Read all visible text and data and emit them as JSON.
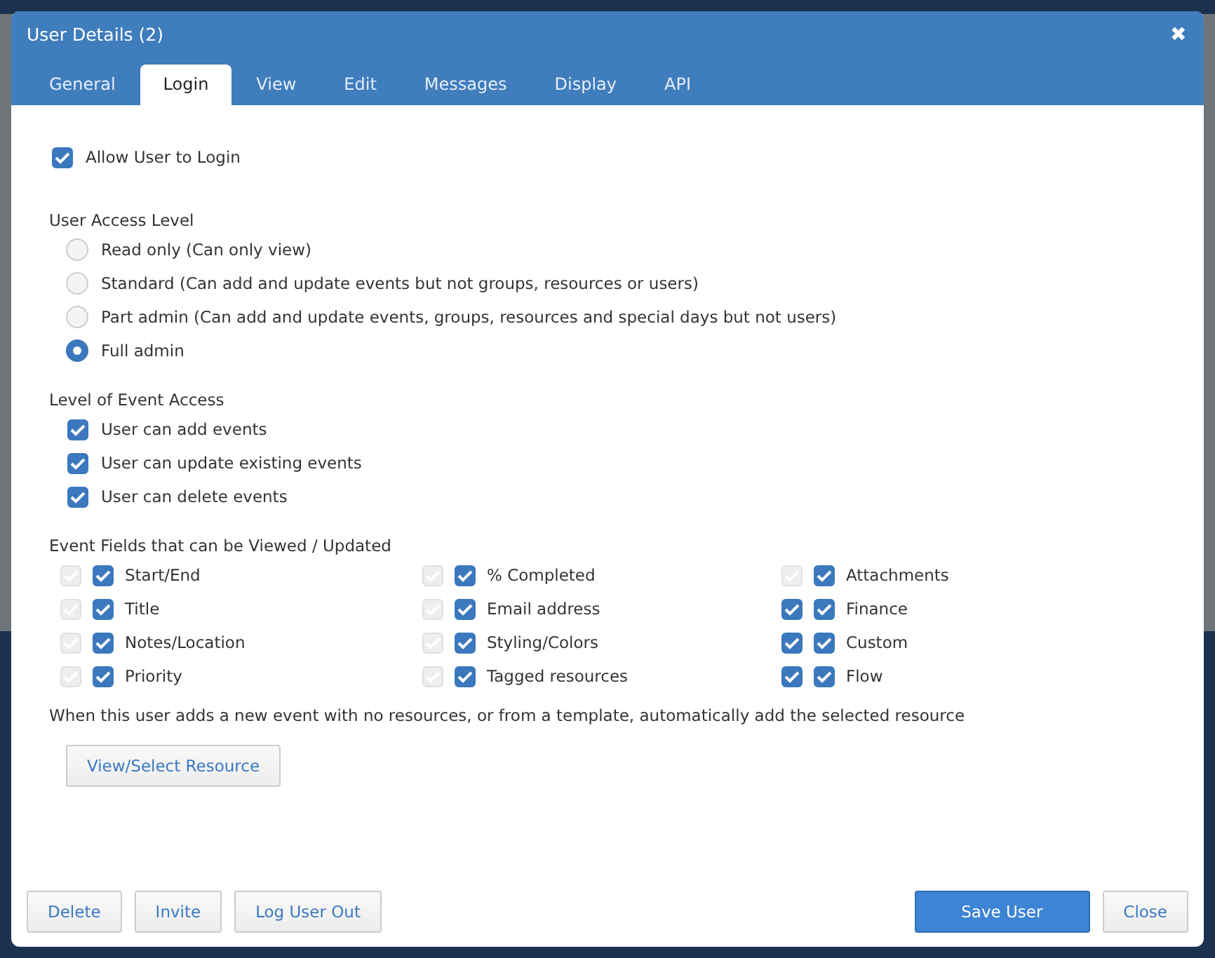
{
  "window": {
    "title": "User Details (2)",
    "close": "✖"
  },
  "tabs": [
    {
      "label": "General",
      "selected": false
    },
    {
      "label": "Login",
      "selected": true
    },
    {
      "label": "View",
      "selected": false
    },
    {
      "label": "Edit",
      "selected": false
    },
    {
      "label": "Messages",
      "selected": false
    },
    {
      "label": "Display",
      "selected": false
    },
    {
      "label": "API",
      "selected": false
    }
  ],
  "allow_login": {
    "label": "Allow User to Login",
    "checked": true
  },
  "access_level": {
    "heading": "User Access Level",
    "options": [
      {
        "label": "Read only (Can only view)",
        "selected": false
      },
      {
        "label": "Standard (Can add and update events but not groups, resources or users)",
        "selected": false
      },
      {
        "label": "Part admin (Can add and update events, groups, resources and special days but not users)",
        "selected": false
      },
      {
        "label": "Full admin",
        "selected": true
      }
    ]
  },
  "event_access": {
    "heading": "Level of Event Access",
    "options": [
      {
        "label": "User can add events",
        "checked": true
      },
      {
        "label": "User can update existing events",
        "checked": true
      },
      {
        "label": "User can delete events",
        "checked": true
      }
    ]
  },
  "event_fields": {
    "heading": "Event Fields that can be Viewed / Updated",
    "columns": [
      [
        {
          "label": "Start/End",
          "view_checked": true,
          "view_disabled": true,
          "update_checked": true
        },
        {
          "label": "Title",
          "view_checked": true,
          "view_disabled": true,
          "update_checked": true
        },
        {
          "label": "Notes/Location",
          "view_checked": true,
          "view_disabled": true,
          "update_checked": true
        },
        {
          "label": "Priority",
          "view_checked": true,
          "view_disabled": true,
          "update_checked": true
        }
      ],
      [
        {
          "label": "% Completed",
          "view_checked": true,
          "view_disabled": true,
          "update_checked": true
        },
        {
          "label": "Email address",
          "view_checked": true,
          "view_disabled": true,
          "update_checked": true
        },
        {
          "label": "Styling/Colors",
          "view_checked": true,
          "view_disabled": true,
          "update_checked": true
        },
        {
          "label": "Tagged resources",
          "view_checked": true,
          "view_disabled": true,
          "update_checked": true
        }
      ],
      [
        {
          "label": "Attachments",
          "view_checked": true,
          "view_disabled": true,
          "update_checked": true
        },
        {
          "label": "Finance",
          "view_checked": true,
          "view_disabled": false,
          "update_checked": true
        },
        {
          "label": "Custom",
          "view_checked": true,
          "view_disabled": false,
          "update_checked": true
        },
        {
          "label": "Flow",
          "view_checked": true,
          "view_disabled": false,
          "update_checked": true
        }
      ]
    ]
  },
  "resource_note": "When this user adds a new event with no resources, or from a template, automatically add the selected resource",
  "resource_button": "View/Select Resource",
  "footer": {
    "left_buttons": [
      "Delete",
      "Invite",
      "Log User Out"
    ],
    "primary": "Save User",
    "close": "Close"
  }
}
